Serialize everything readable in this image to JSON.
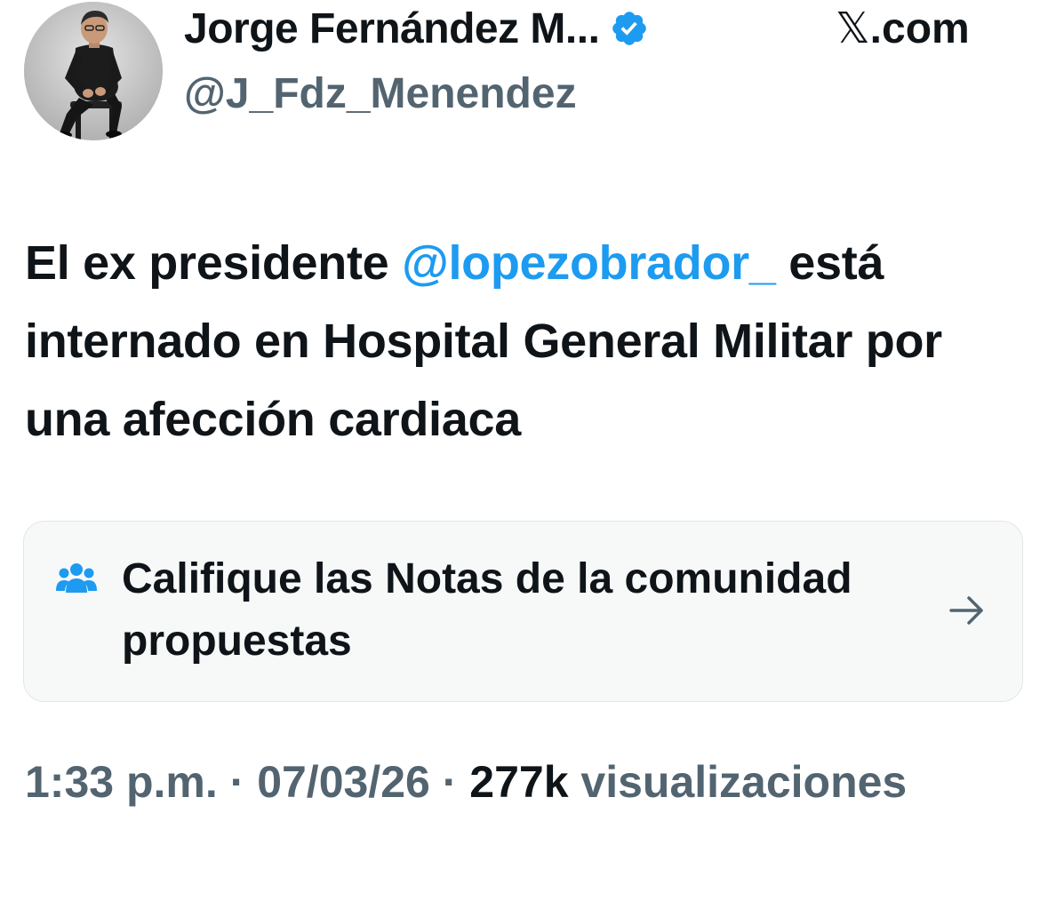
{
  "author": {
    "name": "Jorge Fernández M...",
    "handle": "@J_Fdz_Menendez",
    "verified": true,
    "avatar_icon": "person-avatar"
  },
  "site": {
    "logo": "𝕏",
    "suffix": ".com"
  },
  "tweet": {
    "text_before": "El ex presidente ",
    "mention": "@lopezobrador_",
    "text_after": " está internado en Hospital General Militar por una afección cardiaca"
  },
  "community_notes": {
    "label": "Califique las Notas de la comunidad propuestas",
    "icon": "people-icon",
    "arrow_icon": "arrow-right-icon"
  },
  "meta": {
    "time": "1:33 p.m.",
    "separator1": " · ",
    "date": "07/03/26",
    "separator2": " · ",
    "views_count": "277k",
    "views_label": " visualizaciones"
  },
  "colors": {
    "text": "#0f1419",
    "secondary": "#536471",
    "accent": "#1d9bf0",
    "card_bg": "#f7f9f9",
    "card_border": "#e1e6ea"
  }
}
